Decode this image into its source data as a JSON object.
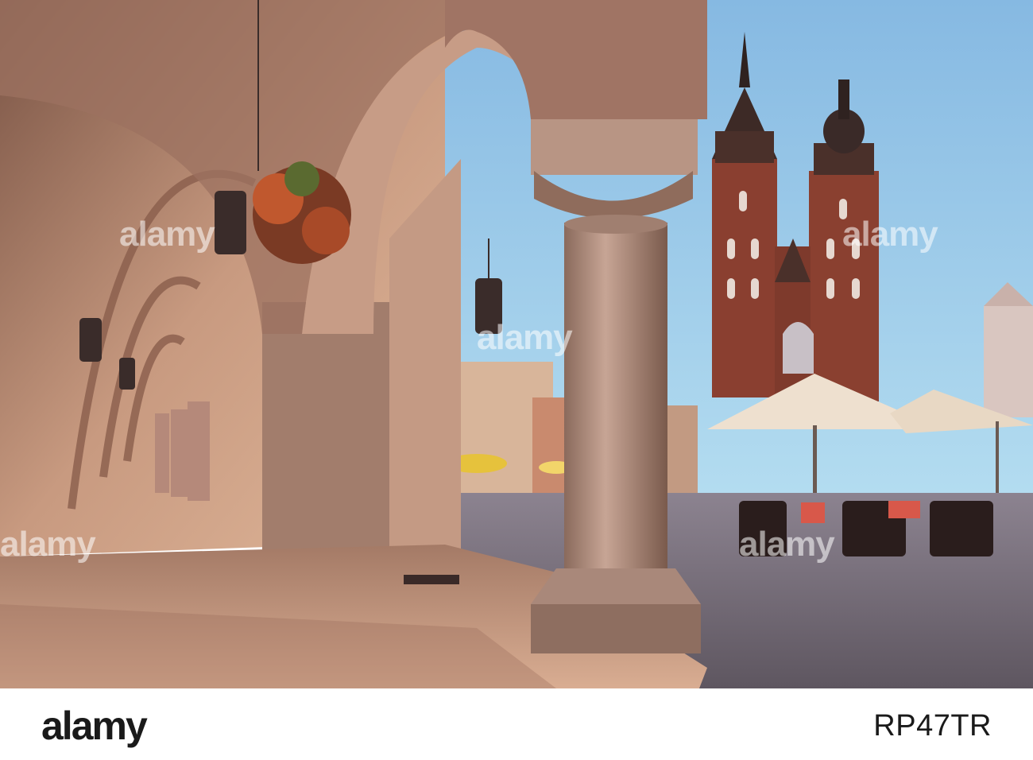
{
  "photo": {
    "scene": "Cloth Hall arcade and St. Mary's Basilica, Main Market Square",
    "colors": {
      "sky_top": "#8fc0e6",
      "sky_bottom": "#a9d6ef",
      "stone": "#b08a78",
      "brick": "#8a3f30",
      "floor": "#d4a98f"
    }
  },
  "watermark": {
    "text": "alamy"
  },
  "footer": {
    "logo": "alamy",
    "image_id": "RP47TR"
  }
}
